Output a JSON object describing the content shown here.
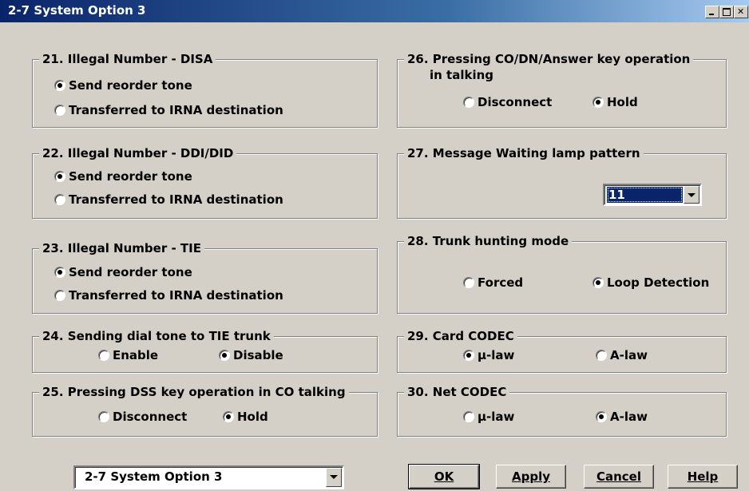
{
  "window": {
    "title": "2-7 System Option 3"
  },
  "groups": {
    "g21": {
      "title": "21. Illegal Number - DISA",
      "options": [
        "Send reorder tone",
        "Transferred to IRNA destination"
      ],
      "selected": 0
    },
    "g22": {
      "title": "22. Illegal Number - DDI/DID",
      "options": [
        "Send reorder tone",
        "Transferred to IRNA destination"
      ],
      "selected": 0
    },
    "g23": {
      "title": "23. Illegal Number - TIE",
      "options": [
        "Send reorder tone",
        "Transferred to IRNA destination"
      ],
      "selected": 0
    },
    "g24": {
      "title": "24. Sending dial tone to TIE trunk",
      "options": [
        "Enable",
        "Disable"
      ],
      "selected": 1
    },
    "g25": {
      "title": "25. Pressing DSS key operation in CO talking",
      "options": [
        "Disconnect",
        "Hold"
      ],
      "selected": 1
    },
    "g26": {
      "title": "26. Pressing CO/DN/Answer key operation",
      "title_line2": "in talking",
      "options": [
        "Disconnect",
        "Hold"
      ],
      "selected": 1
    },
    "g27": {
      "title": "27. Message Waiting lamp pattern",
      "value": "11"
    },
    "g28": {
      "title": "28. Trunk hunting mode",
      "options": [
        "Forced",
        "Loop Detection"
      ],
      "selected": 1
    },
    "g29": {
      "title": "29. Card CODEC",
      "options": [
        "μ-law",
        "A-law"
      ],
      "selected": 0
    },
    "g30": {
      "title": "30. Net CODEC",
      "options": [
        "μ-law",
        "A-law"
      ],
      "selected": 1
    }
  },
  "footer": {
    "page_select": "2-7 System Option 3",
    "buttons": {
      "ok": "OK",
      "apply": "Apply",
      "cancel": "Cancel",
      "help": "Help"
    }
  },
  "colors": {
    "titlebar": "#0a246a",
    "face": "#d4d0c8",
    "selection": "#0a246a"
  }
}
